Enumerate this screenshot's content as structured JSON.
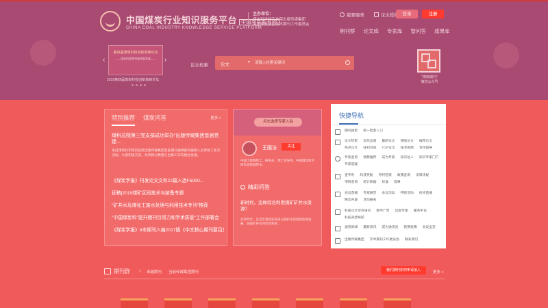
{
  "header": {
    "logo_cn": "中国煤炭行业知识服务平台",
    "logo_badge": "中国煤炭期刊网",
    "logo_en": "CHINA COAL INDUSTRY KNOWLEDGE SERVICE PLATFORM",
    "sponsor_title": "主办单位：",
    "sponsor_line1": "煤炭科学研究总院出版传媒集团",
    "sponsor_line2": "中国煤炭学会学术期刊工作委员会",
    "links": {
      "favorite": "我要服务",
      "publish": "论文投稿"
    },
    "login_label": "登录",
    "register_label": "注册",
    "nav": [
      "期刊群",
      "论文库",
      "专家库",
      "智问答",
      "成果库"
    ]
  },
  "banner": {
    "title": "第四届煤炭科技创新高峰论坛",
    "subtitle": "——煤炭科技期刊高质量发展——",
    "caption": "2018第四届煤炭科技创新高峰论坛"
  },
  "search": {
    "label": "论文检索",
    "select": "论文",
    "placeholder": "请输入检索关键词"
  },
  "qr": {
    "caption_line1": "\"煤炭期刊\"",
    "caption_line2": "微信公众号"
  },
  "featured": {
    "tabs": [
      "特别推荐",
      "煤炭问答"
    ],
    "more": "更多 >",
    "headline": "煤科总院第三党支部成功举办“出版传媒集团首届党建...",
    "desc": "来自煤炭科学研究总院出版传媒集团及各期刊编辑部的编辑人员参加了此次活动，大家积极交流，共同探讨党建与出版工作的融合发展。",
    "list": [
      "《煤炭学报》刊发论文文有22篇入选F5000...",
      "征稿|2019煤矿区段技术与装备专题",
      "\"矿井水及煤化工废水处理与利用技术专刊\"推荐",
      "\"中国煤炭科\"提升期刊引领力和学术质量\"工作部署会",
      "《煤炭学报》8本期刊入编2017版《中文核心期刊要目总"
    ]
  },
  "expert": {
    "banner_button": "点击选择专家入驻",
    "name": "王国法",
    "follow_label": "关注",
    "desc": "中国工程院院士，研究员，博士生导师，中国煤炭科学研究总院副院长。",
    "qa_title": "精彩问答",
    "question": "新时代，怎样综合利用煤矿矿井水资源？",
    "answer": "在新时代，应当实现煤炭开采与保护水资源的协调发展，加强矿井水的综合利用。"
  },
  "quick_nav": {
    "title": "快捷导航",
    "rows": [
      {
        "icon": "journal-icon",
        "items": [
          "期刊搜索",
          "统一检索入口"
        ]
      },
      {
        "icon": "paper-icon",
        "items": [
          "论文检索",
          "优先出版",
          "最新论文",
          "增强论文",
          "推荐论文",
          "热点论文",
          "往刊浏览",
          "TOP论文",
          "技术视频",
          "写作指导"
        ]
      },
      {
        "icon": "expert-icon",
        "items": [
          "专家查询",
          "我要推荐",
          "成为专家",
          "知识达人",
          "知识专家门户",
          "专家答疑"
        ]
      },
      {
        "icon": "achievement-icon",
        "items": [
          "查专利",
          "科技奖励",
          "专利检索",
          "政策查询",
          "法律法规",
          "项目查询",
          "统计数据",
          "标准",
          "成果"
        ]
      },
      {
        "icon": "meeting-icon",
        "items": [
          "会议直播",
          "专家报告",
          "会议活动",
          "特别活动",
          "技术直播",
          "精华内容",
          "活动报名"
        ]
      },
      {
        "icon": "service-icon",
        "items": [
          "科技论文写作培训",
          "数字广告",
          "出版专家",
          "服务平台",
          "科技资源导航"
        ]
      },
      {
        "icon": "notice-icon",
        "items": [
          "通讯新闻",
          "最新资讯",
          "成为通讯员",
          "我要投稿",
          "会议全览"
        ]
      },
      {
        "icon": "publisher-icon",
        "items": [
          "出版传媒集团",
          "学术期刊工作委员会",
          "联系我们"
        ]
      }
    ]
  },
  "periodical": {
    "label": "期刊群",
    "links": [
      "卓越期刊",
      "当前传媒集团期刊"
    ],
    "apply_button": "我们期刊如何申请加入",
    "more": "更多 >"
  }
}
